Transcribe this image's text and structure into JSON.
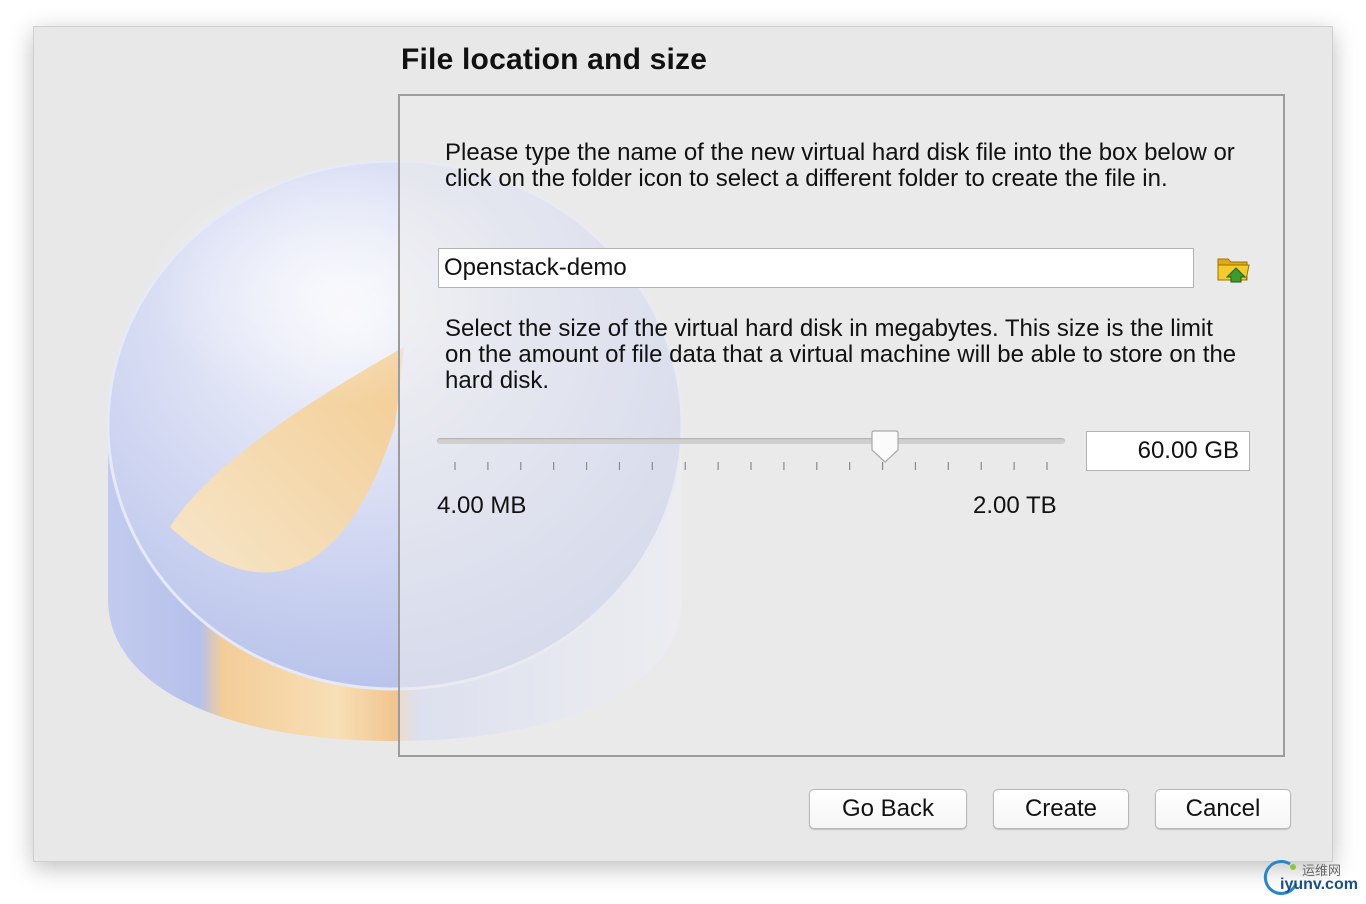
{
  "page": {
    "title": "File location and size"
  },
  "file_section": {
    "description": "Please type the name of the new virtual hard disk file into the box below or click on the folder icon to select a different folder to create the file in.",
    "file_name": "Openstack-demo",
    "folder_icon": "folder-open-icon"
  },
  "size_section": {
    "description": "Select the size of the virtual hard disk in megabytes. This size is the limit on the amount of file data that a virtual machine will be able to store on the hard disk.",
    "slider": {
      "position_fraction": 0.714,
      "tick_count": 19
    },
    "min_label": "4.00 MB",
    "max_label": "2.00 TB",
    "size_value": "60.00 GB"
  },
  "buttons": {
    "go_back": "Go Back",
    "create": "Create",
    "cancel": "Cancel"
  },
  "watermark": {
    "top": "运维网",
    "bottom": "iyunv.com"
  },
  "colors": {
    "dialog_background": "#e8e8e8",
    "disk_blue": "#b9c4ec",
    "disk_orange": "#f2c88e",
    "folder_yellow": "#f0c419",
    "folder_arrow_green": "#3c9a2e"
  }
}
